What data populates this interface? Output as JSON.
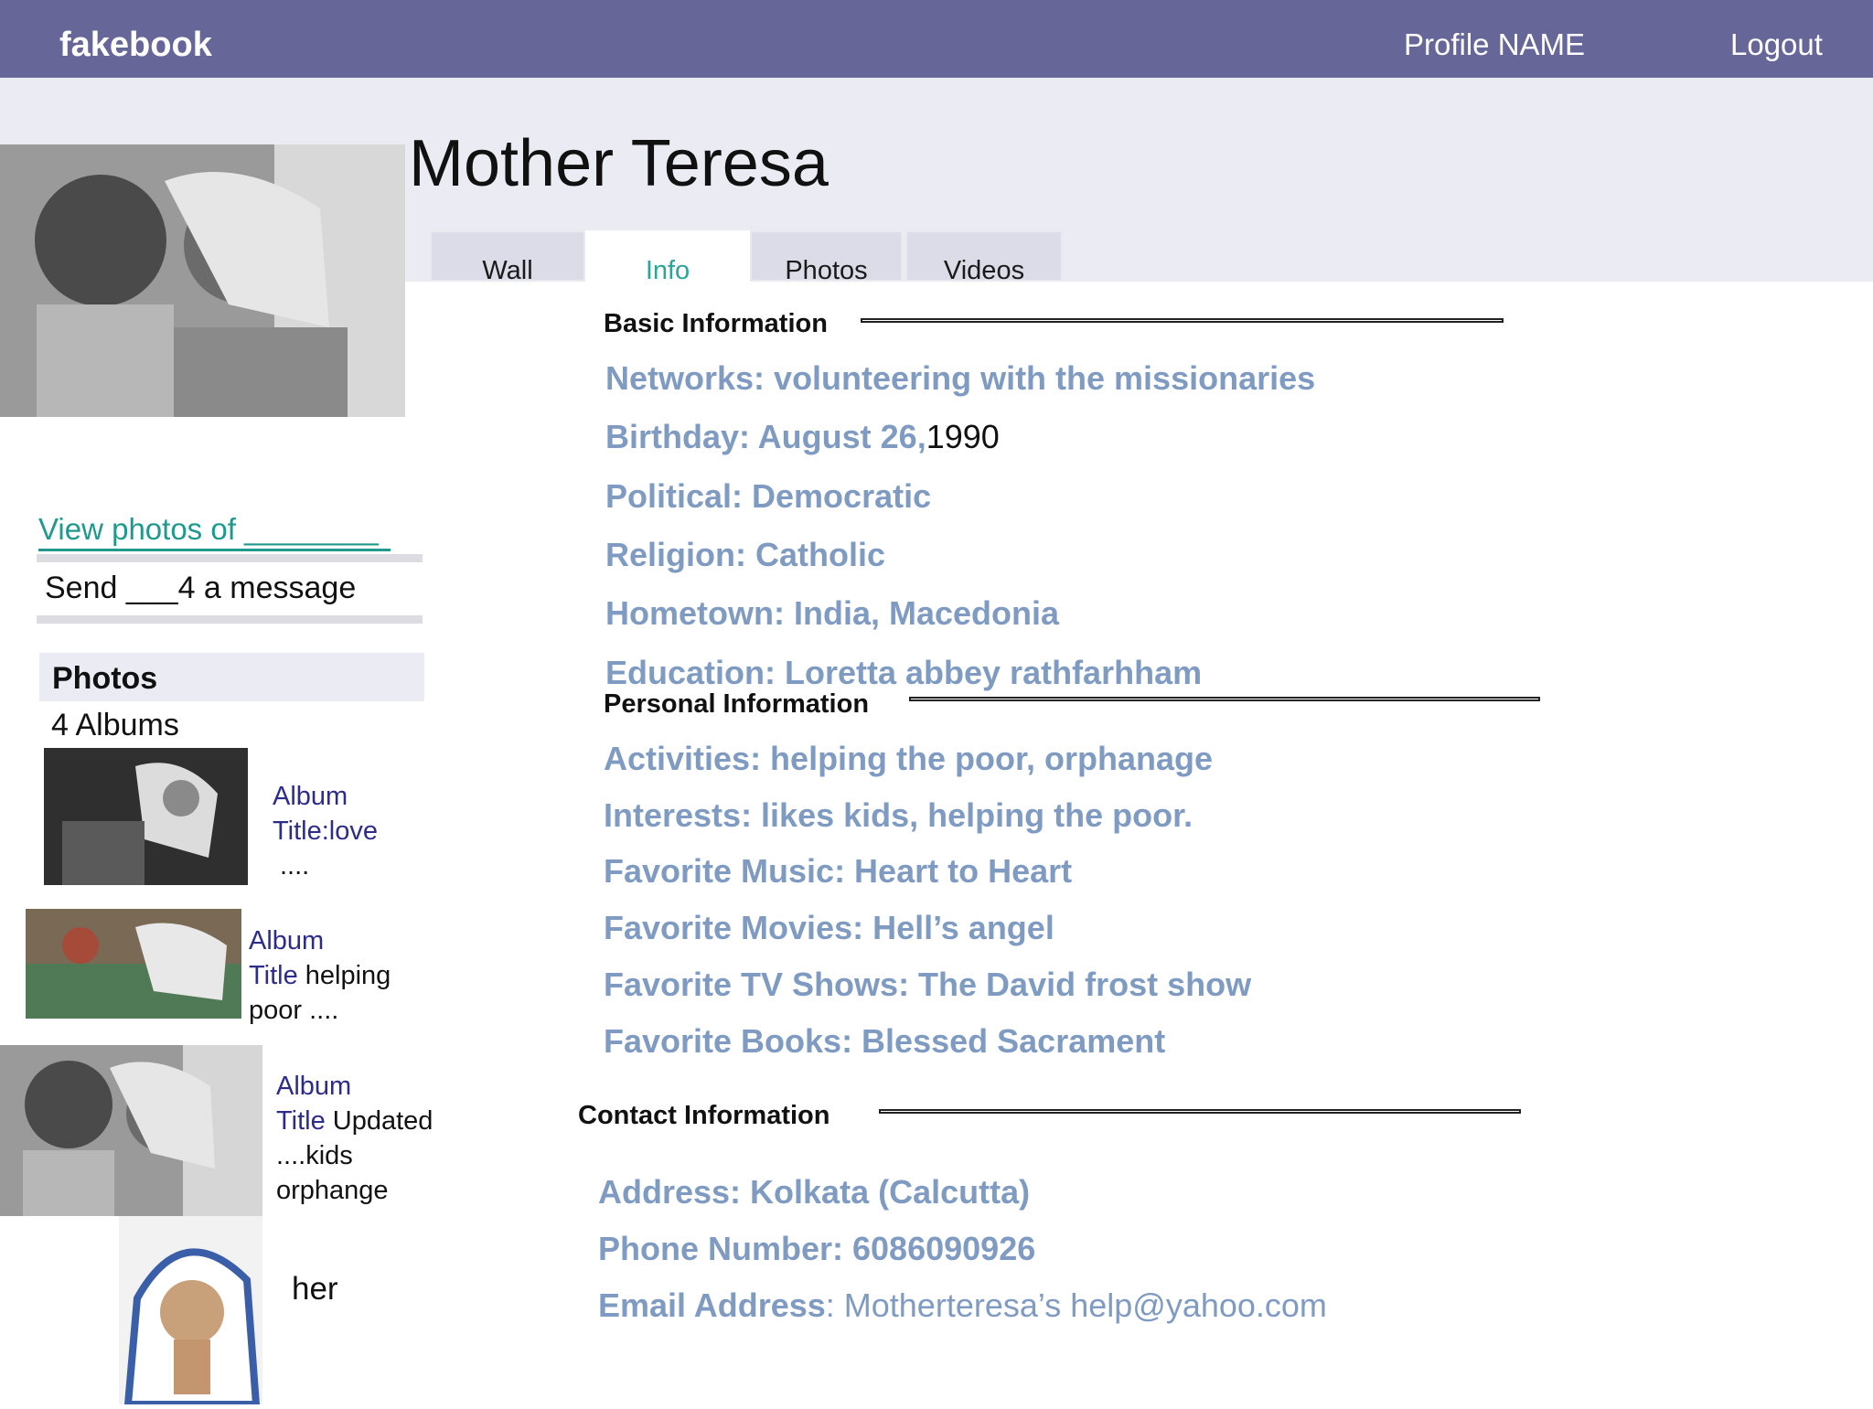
{
  "topbar": {
    "brand": "fakebook",
    "profile_link": "Profile NAME",
    "logout_link": "Logout"
  },
  "profile": {
    "name": "Mother Teresa"
  },
  "tabs": [
    {
      "label": "Wall",
      "active": false
    },
    {
      "label": "Info",
      "active": true
    },
    {
      "label": "Photos",
      "active": false
    },
    {
      "label": "Videos",
      "active": false
    }
  ],
  "sidebar": {
    "view_photos": "View photos of ________",
    "send_message": "Send ___4 a message",
    "photos_heading": "Photos",
    "albums_count": "4 Albums",
    "albums": [
      {
        "line1": "Album",
        "line2": "Title:love",
        "line3": "...."
      },
      {
        "line1": "Album",
        "line2_blue": "Title",
        "line2_rest": " helping",
        "line3": "poor ...."
      },
      {
        "line1": "Album",
        "line2_blue": "Title",
        "line2_rest": " Updated",
        "line3": "....kids",
        "line4": "orphange"
      },
      {
        "caption": "her"
      }
    ]
  },
  "basic_info": {
    "heading": "Basic Information",
    "networks": "Networks: volunteering with the missionaries",
    "birthday_label": "Birthday: August 26,",
    "birthday_year": "1990",
    "political": "Political: Democratic",
    "religion": "Religion: Catholic",
    "hometown": "Hometown: India, Macedonia",
    "education": "Education: Loretta abbey rathfarhham"
  },
  "personal_info": {
    "heading": "Personal Information",
    "activities": "Activities: helping the poor, orphanage",
    "interests": "Interests: likes kids, helping the poor.",
    "music": "Favorite Music: Heart  to Heart",
    "movies": "Favorite Movies: Hell’s angel",
    "tv": "Favorite TV Shows: The David frost show",
    "books": "Favorite Books: Blessed Sacrament"
  },
  "contact_info": {
    "heading": "Contact Information",
    "address": "Address: Kolkata (Calcutta)",
    "phone": "Phone Number: 6086090926",
    "email_label": "Email Address",
    "email_value": ": Motherteresa’s help@yahoo.com"
  },
  "colors": {
    "topbar": "#676699",
    "header_band": "#ebebf3",
    "link_teal": "#20998c",
    "field_blue": "#7f9bc1",
    "album_blue": "#2e2c8a"
  }
}
